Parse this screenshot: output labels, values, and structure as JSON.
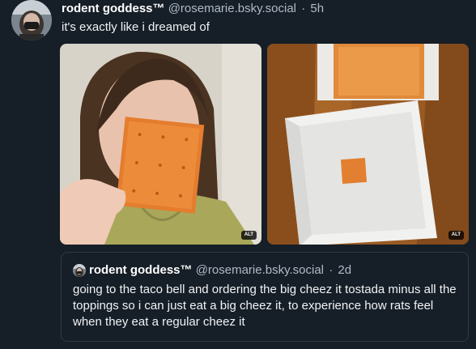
{
  "post": {
    "author": "rodent goddess™",
    "handle": "@rosemarie.bsky.social",
    "separator": "·",
    "time": "5h",
    "text": "it's exactly like i dreamed of",
    "images": [
      {
        "alt_badge": "ALT",
        "icon": "photo-selfie-with-cracker"
      },
      {
        "alt_badge": "ALT",
        "icon": "photo-cracker-in-box"
      }
    ]
  },
  "quote": {
    "author": "rodent goddess™",
    "handle": "@rosemarie.bsky.social",
    "separator": "·",
    "time": "2d",
    "text": "going to the taco bell and ordering the big cheez it tostada minus all the toppings so i can just eat a big cheez it, to experience how rats feel when they eat a regular cheez it"
  },
  "colors": {
    "background": "#161e27",
    "text": "#f1f3f5",
    "muted": "#aebbc9",
    "quote_border": "#2e3a48"
  }
}
